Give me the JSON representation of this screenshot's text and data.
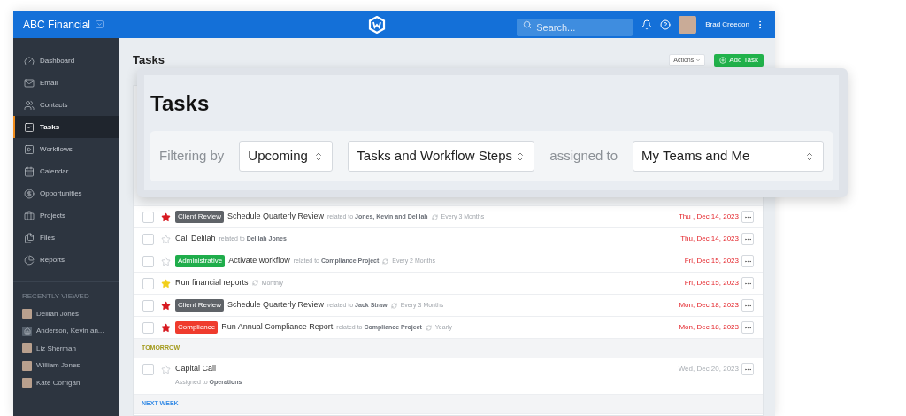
{
  "header": {
    "org": "ABC Financial",
    "search_placeholder": "Search...",
    "user": "Brad Creedon"
  },
  "sidebar": {
    "items": [
      {
        "label": "Dashboard",
        "selected": false
      },
      {
        "label": "Email",
        "selected": false
      },
      {
        "label": "Contacts",
        "selected": false
      },
      {
        "label": "Tasks",
        "selected": true
      },
      {
        "label": "Workflows",
        "selected": false
      },
      {
        "label": "Calendar",
        "selected": false
      },
      {
        "label": "Opportunities",
        "selected": false
      },
      {
        "label": "Projects",
        "selected": false
      },
      {
        "label": "Files",
        "selected": false
      },
      {
        "label": "Reports",
        "selected": false
      }
    ],
    "recent_heading": "RECENTLY VIEWED",
    "recent": [
      {
        "name": "Delilah Jones",
        "kind": "person"
      },
      {
        "name": "Anderson, Kevin an...",
        "kind": "household"
      },
      {
        "name": "Liz Sherman",
        "kind": "person"
      },
      {
        "name": "William Jones",
        "kind": "person"
      },
      {
        "name": "Kate Corrigan",
        "kind": "person"
      }
    ]
  },
  "page": {
    "title": "Tasks",
    "actions": "Actions",
    "add": "Add Task"
  },
  "zoom_panel": {
    "title": "Tasks",
    "filter_label": "Filtering by",
    "period": "Upcoming",
    "type": "Tasks and Workflow Steps",
    "assigned_label": "assigned to",
    "assignee": "My Teams and Me"
  },
  "sections": [
    {
      "rows": [
        {
          "checked": false,
          "starred": true,
          "color": "#d71920",
          "tag": {
            "label": "Client Review",
            "color": "#5f6368"
          },
          "title": "Schedule Quarterly Review",
          "related_prefix": "related to",
          "related": "Jones, Kevin and Delilah",
          "recurrence": "Every 3 Months",
          "date": "Thu , Dec 14, 2023",
          "overdue": true
        },
        {
          "checked": false,
          "starred": false,
          "title": "Call Delilah",
          "related_prefix": "related to",
          "related": "Delilah Jones",
          "date": "Thu, Dec 14, 2023",
          "overdue": true
        },
        {
          "checked": false,
          "starred": false,
          "tag": {
            "label": "Administrative",
            "color": "#1fad4b"
          },
          "title": "Activate workflow",
          "related_prefix": "related to",
          "related": "Compliance Project",
          "recurrence": "Every 2 Months",
          "date": "Fri, Dec 15, 2023",
          "overdue": true
        },
        {
          "checked": false,
          "starred": true,
          "color": "#f2cf1a",
          "title": "Run financial reports",
          "recurrence": "Monthly",
          "date": "Fri, Dec 15, 2023",
          "overdue": true
        },
        {
          "checked": false,
          "starred": true,
          "color": "#d71920",
          "tag": {
            "label": "Client Review",
            "color": "#5f6368"
          },
          "title": "Schedule Quarterly Review",
          "related_prefix": "related to",
          "related": "Jack Straw",
          "recurrence": "Every 3 Months",
          "date": "Mon, Dec 18, 2023",
          "overdue": true
        },
        {
          "checked": false,
          "starred": true,
          "color": "#d71920",
          "tag": {
            "label": "Compliance",
            "color": "#ef3b2d"
          },
          "title": "Run Annual Compliance Report",
          "related_prefix": "related to",
          "related": "Compliance Project",
          "recurrence": "Yearly",
          "date": "Mon, Dec 18, 2023",
          "overdue": true
        }
      ]
    },
    {
      "heading": "TOMORROW",
      "color": "#a39a1c",
      "rows": [
        {
          "checked": false,
          "starred": false,
          "title": "Capital Call",
          "assigned_prefix": "Assigned to",
          "assigned": "Operations",
          "date": "Wed, Dec 20, 2023",
          "overdue": false
        }
      ]
    },
    {
      "heading": "NEXT WEEK",
      "color": "#3a8ee6"
    }
  ]
}
